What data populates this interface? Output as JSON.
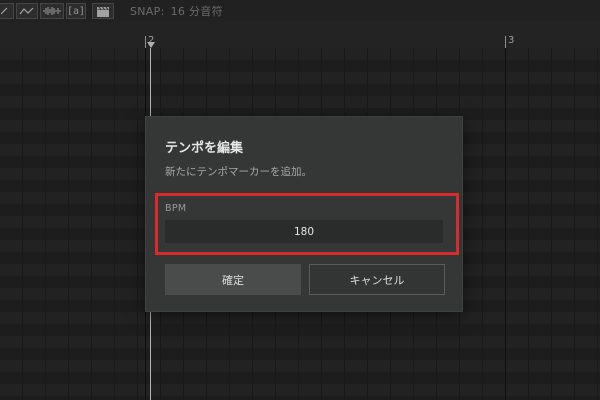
{
  "toolbar": {
    "tools": [
      {
        "name": "pencil-tool",
        "icon": "pencil-icon"
      },
      {
        "name": "curve-tool",
        "icon": "curve-icon"
      },
      {
        "name": "waveform-tool",
        "icon": "waveform-icon"
      },
      {
        "name": "lyric-tool",
        "icon": "lyric-icon",
        "label": "a"
      },
      {
        "name": "video-tool",
        "icon": "clapperboard-icon"
      }
    ],
    "snap_label": "SNAP:",
    "snap_value": "16 分音符"
  },
  "ruler": {
    "bars": [
      "2",
      "3"
    ]
  },
  "dialog": {
    "title": "テンポを編集",
    "description": "新たにテンポマーカーを追加。",
    "bpm_label": "BPM",
    "bpm_value": "180",
    "confirm_label": "確定",
    "cancel_label": "キャンセル",
    "highlight_color": "#d92b2b"
  }
}
